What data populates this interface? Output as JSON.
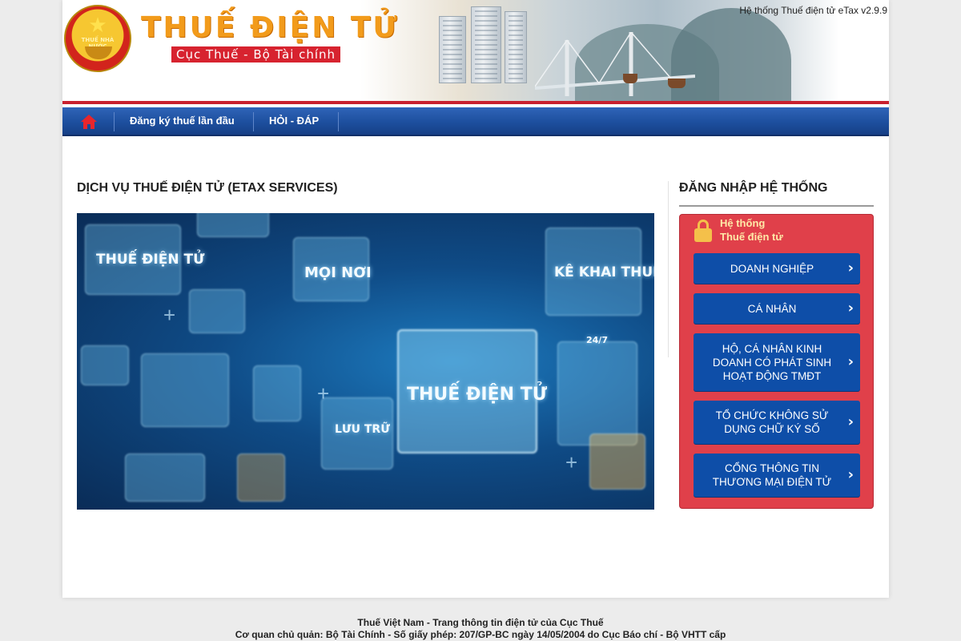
{
  "header": {
    "title": "THUẾ ĐIỆN TỬ",
    "subtitle": "Cục Thuế - Bộ Tài chính",
    "emblem_text": "THUẾ NHÀ NƯỚC",
    "version": "Hệ thống Thuế điện tử eTax v2.9.9"
  },
  "nav": {
    "items": [
      {
        "label": "Đăng ký thuế lần đầu"
      },
      {
        "label": "HỎI - ĐÁP"
      }
    ]
  },
  "main": {
    "services_title": "DỊCH VỤ THUẾ ĐIỆN TỬ (ETAX SERVICES)",
    "hero": {
      "tile_labels": [
        "THUẾ ĐIỆN TỬ",
        "MỌI NƠI",
        "KÊ KHAI THUẾ",
        "THUẾ ĐIỆN TỬ",
        "LƯU TRỮ",
        "24/7"
      ]
    }
  },
  "login": {
    "title": "ĐĂNG NHẬP HỆ THỐNG",
    "system_line1": "Hệ thống",
    "system_line2": "Thuế điện tử",
    "buttons": [
      {
        "label": "DOANH NGHIỆP"
      },
      {
        "label": "CÁ NHÂN"
      },
      {
        "label": "HỘ, CÁ NHÂN KINH DOANH CÓ PHÁT SINH HOẠT ĐỘNG TMĐT"
      },
      {
        "label": "TỔ CHỨC KHÔNG SỬ DỤNG CHỮ KÝ SỐ"
      },
      {
        "label": "CỔNG THÔNG TIN THƯƠNG MẠI ĐIỆN TỬ"
      }
    ]
  },
  "footer": {
    "line1": "Thuế Việt Nam - Trang thông tin điện tử của Cục Thuế",
    "line2": "Cơ quan chủ quản: Bộ Tài Chính - Số giấy phép: 207/GP-BC ngày 14/05/2004 do Cục Báo chí - Bộ VHTT cấp"
  },
  "colors": {
    "nav_blue": "#1d4f9e",
    "brand_orange": "#f29b1b",
    "accent_red": "#d7232f",
    "login_panel": "#e0404a",
    "login_button": "#0e4ea8"
  }
}
